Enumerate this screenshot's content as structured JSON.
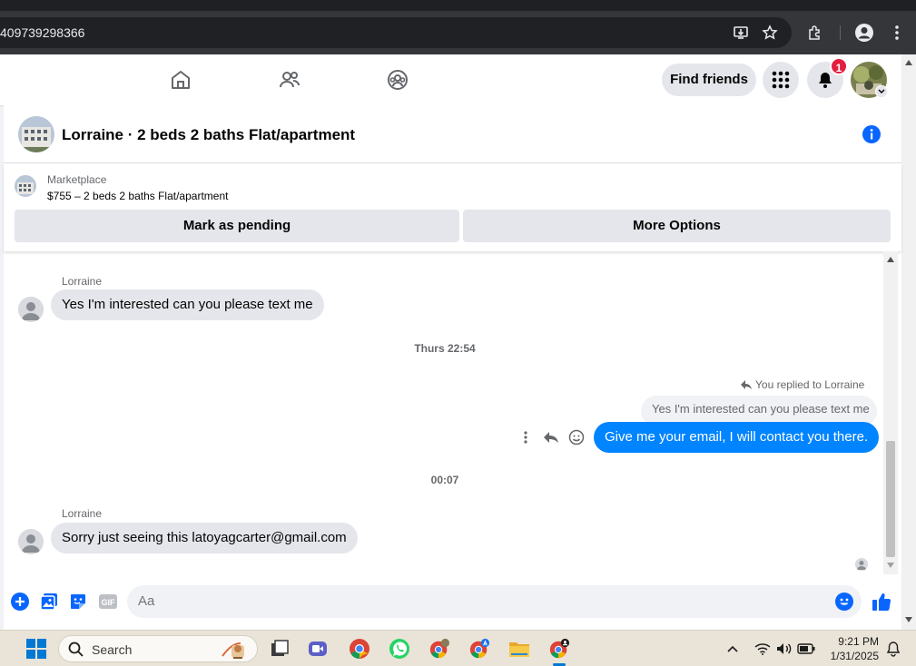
{
  "browser": {
    "url_fragment": "409739298366",
    "icons": [
      "install-app-icon",
      "bookmark-star-icon",
      "extensions-icon",
      "profile-icon",
      "kebab-menu-icon"
    ]
  },
  "nav": {
    "find_friends_label": "Find friends",
    "notification_count": "1",
    "tabs": [
      "home-icon",
      "friends-icon",
      "groups-icon"
    ]
  },
  "chat": {
    "title": "Lorraine · 2 beds 2 baths Flat/apartment",
    "marketplace": {
      "label": "Marketplace",
      "description": "$755 – 2 beds 2 baths Flat/apartment",
      "mark_pending_label": "Mark as pending",
      "more_options_label": "More Options"
    },
    "messages": {
      "msg1_sender": "Lorraine",
      "msg1_text": "Yes I'm interested can you please text me",
      "time1": "Thurs 22:54",
      "replied_note": "You replied to Lorraine",
      "quoted_text": "Yes I'm interested can you please text me",
      "reply_text": "Give me your email, I will contact you there.",
      "time2": "00:07",
      "msg2_sender": "Lorraine",
      "msg2_text": "Sorry just seeing this latoyagcarter@gmail.com"
    },
    "composer": {
      "placeholder": "Aa",
      "gif_label": "GIF"
    }
  },
  "taskbar": {
    "search_label": "Search",
    "time": "9:21 PM",
    "date": "1/31/2025"
  },
  "colors": {
    "accent": "#0084ff",
    "fb_blue": "#0866ff",
    "badge_red": "#e41e3f"
  }
}
